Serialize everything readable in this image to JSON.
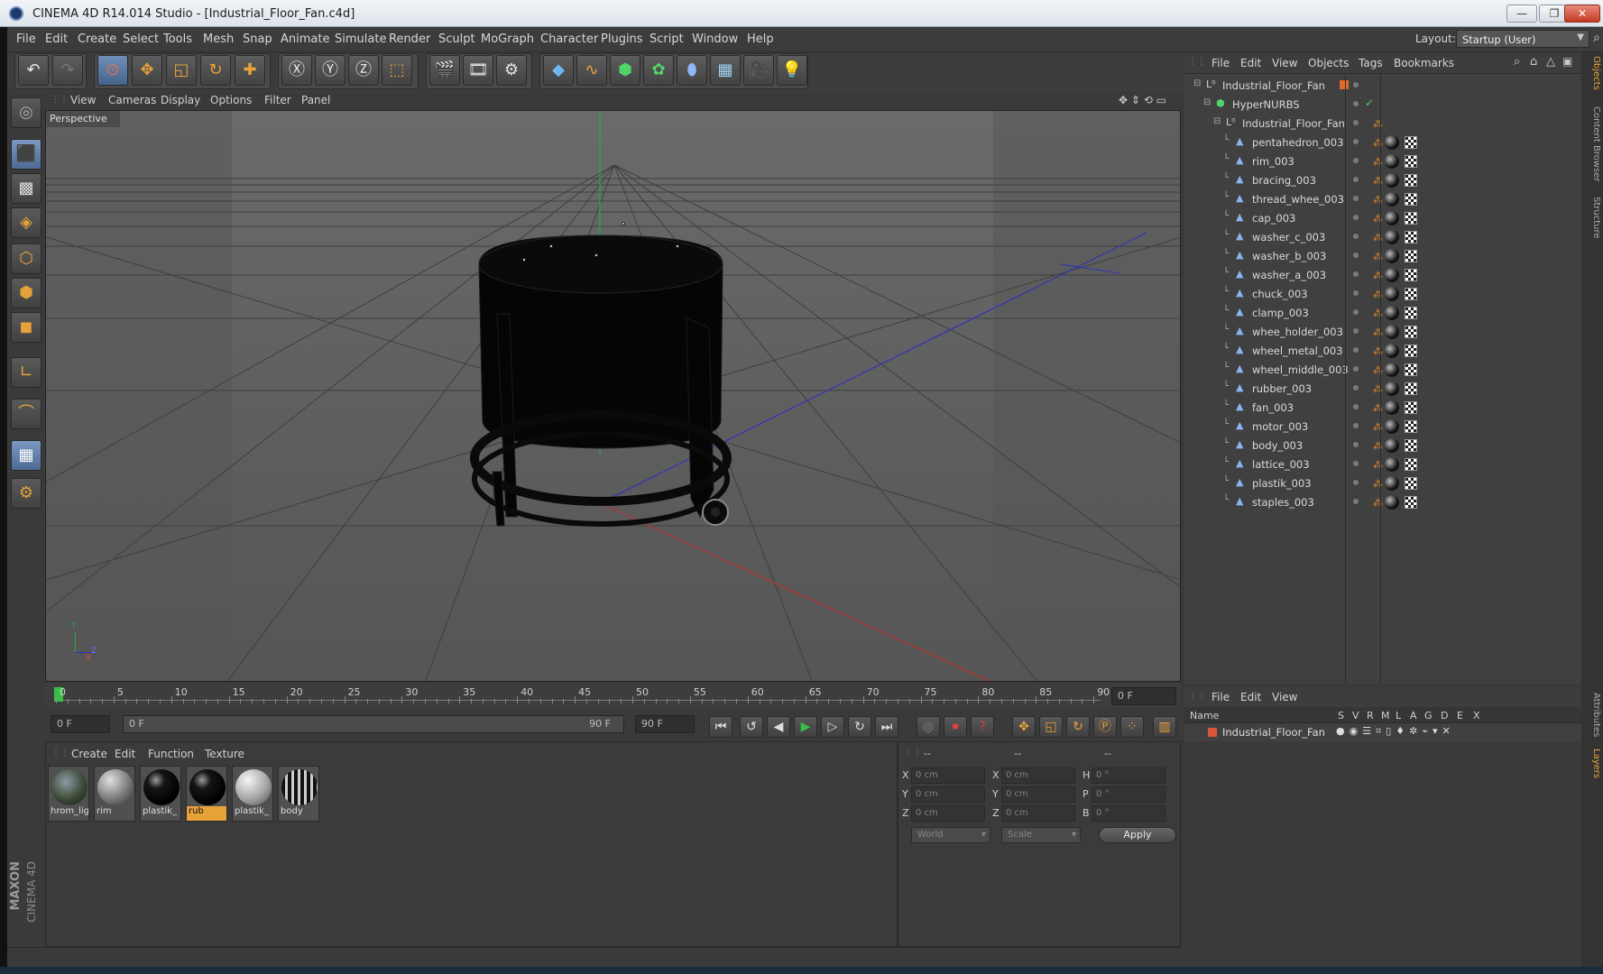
{
  "window": {
    "title": "CINEMA 4D R14.014 Studio - [Industrial_Floor_Fan.c4d]",
    "controls": [
      "—",
      "❐",
      "✕"
    ]
  },
  "menubar": {
    "items": [
      "File",
      "Edit",
      "Create",
      "Select",
      "Tools",
      "Mesh",
      "Snap",
      "Animate",
      "Simulate",
      "Render",
      "Sculpt",
      "MoGraph",
      "Character",
      "Plugins",
      "Script",
      "Window",
      "Help"
    ],
    "layout_label": "Layout:",
    "layout_value": "Startup (User)"
  },
  "viewport": {
    "menu": [
      "View",
      "Cameras",
      "Display",
      "Options",
      "Filter",
      "Panel"
    ],
    "label": "Perspective",
    "axis_labels": {
      "y": "Y",
      "z": "Z",
      "x": "X"
    }
  },
  "timeline": {
    "ticks": [
      "0",
      "5",
      "10",
      "15",
      "20",
      "25",
      "30",
      "35",
      "40",
      "45",
      "50",
      "55",
      "60",
      "65",
      "70",
      "75",
      "80",
      "85",
      "90"
    ],
    "end_field": "0 F"
  },
  "transport": {
    "current_frame": "0 F",
    "range_start": "0 F",
    "range_end": "90 F",
    "max_frame": "90 F"
  },
  "materials": {
    "menu": [
      "Create",
      "Edit",
      "Function",
      "Texture"
    ],
    "items": [
      {
        "label": "hrom_lig",
        "style": "env"
      },
      {
        "label": "rim",
        "style": "grey"
      },
      {
        "label": "plastik_",
        "style": "black"
      },
      {
        "label": "rub",
        "style": "black",
        "selected": true
      },
      {
        "label": "plastik_",
        "style": "lightgrey"
      },
      {
        "label": "body",
        "style": "pattern"
      }
    ]
  },
  "coordinates": {
    "headers": [
      "--",
      "--",
      "--"
    ],
    "rows": [
      {
        "l1": "X",
        "v1": "0 cm",
        "l2": "X",
        "v2": "0 cm",
        "l3": "H",
        "v3": "0 °"
      },
      {
        "l1": "Y",
        "v1": "0 cm",
        "l2": "Y",
        "v2": "0 cm",
        "l3": "P",
        "v3": "0 °"
      },
      {
        "l1": "Z",
        "v1": "0 cm",
        "l2": "Z",
        "v2": "0 cm",
        "l3": "B",
        "v3": "0 °"
      }
    ],
    "mode1": "World",
    "mode2": "Scale",
    "apply": "Apply"
  },
  "objects": {
    "menu": [
      "File",
      "Edit",
      "View",
      "Objects",
      "Tags",
      "Bookmarks"
    ],
    "rows": [
      {
        "name": "Industrial_Floor_Fan",
        "indent": 0,
        "type": "null",
        "tags": false
      },
      {
        "name": "HyperNURBS",
        "indent": 1,
        "type": "nurbs",
        "tags": false
      },
      {
        "name": "Industrial_Floor_Fan",
        "indent": 2,
        "type": "null",
        "tags": false
      },
      {
        "name": "pentahedron_003",
        "indent": 3,
        "type": "mesh",
        "tags": true
      },
      {
        "name": "rim_003",
        "indent": 3,
        "type": "mesh",
        "tags": true
      },
      {
        "name": "bracing_003",
        "indent": 3,
        "type": "mesh",
        "tags": true
      },
      {
        "name": "thread_whee_003",
        "indent": 3,
        "type": "mesh",
        "tags": true
      },
      {
        "name": "cap_003",
        "indent": 3,
        "type": "mesh",
        "tags": true
      },
      {
        "name": "washer_c_003",
        "indent": 3,
        "type": "mesh",
        "tags": true
      },
      {
        "name": "washer_b_003",
        "indent": 3,
        "type": "mesh",
        "tags": true
      },
      {
        "name": "washer_a_003",
        "indent": 3,
        "type": "mesh",
        "tags": true
      },
      {
        "name": "chuck_003",
        "indent": 3,
        "type": "mesh",
        "tags": true
      },
      {
        "name": "clamp_003",
        "indent": 3,
        "type": "mesh",
        "tags": true
      },
      {
        "name": "whee_holder_003",
        "indent": 3,
        "type": "mesh",
        "tags": true
      },
      {
        "name": "wheel_metal_003",
        "indent": 3,
        "type": "mesh",
        "tags": true
      },
      {
        "name": "wheel_middle_003",
        "indent": 3,
        "type": "mesh",
        "tags": true
      },
      {
        "name": "rubber_003",
        "indent": 3,
        "type": "mesh",
        "tags": true
      },
      {
        "name": "fan_003",
        "indent": 3,
        "type": "mesh",
        "tags": true
      },
      {
        "name": "motor_003",
        "indent": 3,
        "type": "mesh",
        "tags": true
      },
      {
        "name": "body_003",
        "indent": 3,
        "type": "mesh",
        "tags": true
      },
      {
        "name": "lattice_003",
        "indent": 3,
        "type": "mesh",
        "tags": true
      },
      {
        "name": "plastik_003",
        "indent": 3,
        "type": "mesh",
        "tags": true
      },
      {
        "name": "staples_003",
        "indent": 3,
        "type": "mesh",
        "tags": true
      }
    ]
  },
  "layers": {
    "menu": [
      "File",
      "Edit",
      "View"
    ],
    "columns": [
      "Name",
      "S",
      "V",
      "R",
      "M",
      "L",
      "A",
      "G",
      "D",
      "E",
      "X"
    ],
    "rows": [
      {
        "name": "Industrial_Floor_Fan"
      }
    ]
  },
  "side_tabs": [
    "Objects",
    "Content Browser",
    "Structure",
    "Attributes",
    "Layers"
  ],
  "brand": {
    "maxon": "MAXON",
    "product": "CINEMA 4D"
  },
  "colors": {
    "accent": "#e8a23a",
    "selection": "#6f8fb8",
    "close": "#c43b25"
  }
}
